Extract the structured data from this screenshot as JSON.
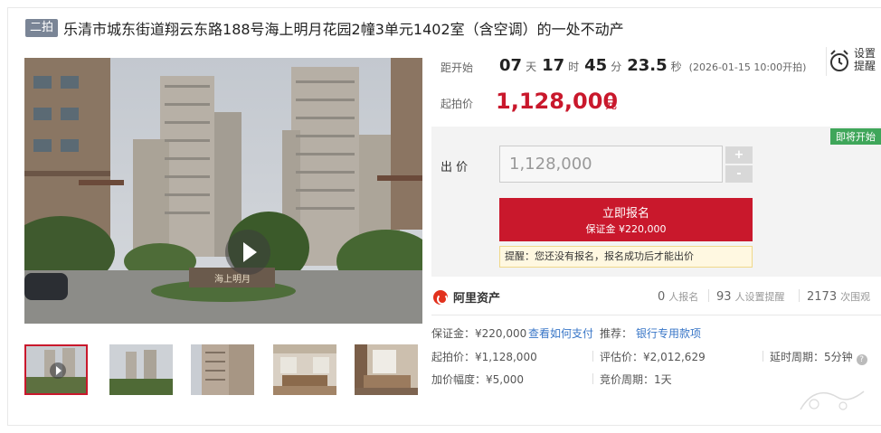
{
  "header": {
    "tag": "二拍",
    "title": "乐清市城东街道翔云东路188号海上明月花园2幢3单元1402室（含空调）的一处不动产"
  },
  "media": {
    "play_icon": "play-icon",
    "gate_sign": "海上明月",
    "thumbnails": [
      {
        "name": "thumb-video",
        "has_play": true,
        "active": true
      },
      {
        "name": "thumb-towers",
        "has_play": false,
        "active": false
      },
      {
        "name": "thumb-building",
        "has_play": false,
        "active": false
      },
      {
        "name": "thumb-living-room",
        "has_play": false,
        "active": false
      },
      {
        "name": "thumb-bedroom",
        "has_play": false,
        "active": false
      }
    ]
  },
  "countdown": {
    "label": "距开始",
    "days": "07",
    "days_unit": "天",
    "hours": "17",
    "hours_unit": "时",
    "minutes": "45",
    "minutes_unit": "分",
    "seconds": "23.5",
    "seconds_unit": "秒",
    "start_time": "(2026-01-15 10:00开拍)"
  },
  "remind": {
    "icon": "alarm-clock-icon",
    "label": "设置提醒"
  },
  "price": {
    "label": "起拍价",
    "value": "1,128,000",
    "unit": "元"
  },
  "bid": {
    "badge": "即将开始",
    "label": "出 价",
    "input_value": "1,128,000",
    "plus": "+",
    "minus": "-",
    "apply_label": "立即报名",
    "deposit_label": "保证金 ¥220,000",
    "tip": "提醒：您还没有报名，报名成功后才能出价"
  },
  "stats": {
    "brand": "阿里资产",
    "signups": "0",
    "signups_label": "人报名",
    "reminders": "93",
    "reminders_label": "人设置提醒",
    "views": "2173",
    "views_label": "次围观"
  },
  "details": {
    "deposit": "保证金：¥220,000",
    "how_to_pay": "查看如何支付",
    "recommend_label": "推荐：",
    "recommend_link": "银行专用款项",
    "start_price": "起拍价：¥1,128,000",
    "appraisal": "评估价：¥2,012,629",
    "delay": "延时周期：5分钟",
    "increment": "加价幅度：¥5,000",
    "period": "竞价周期：1天"
  },
  "colors": {
    "accent_red": "#c9182c",
    "badge_green": "#3fa65a",
    "link_blue": "#3876c7",
    "tag_gray": "#7a8596"
  }
}
